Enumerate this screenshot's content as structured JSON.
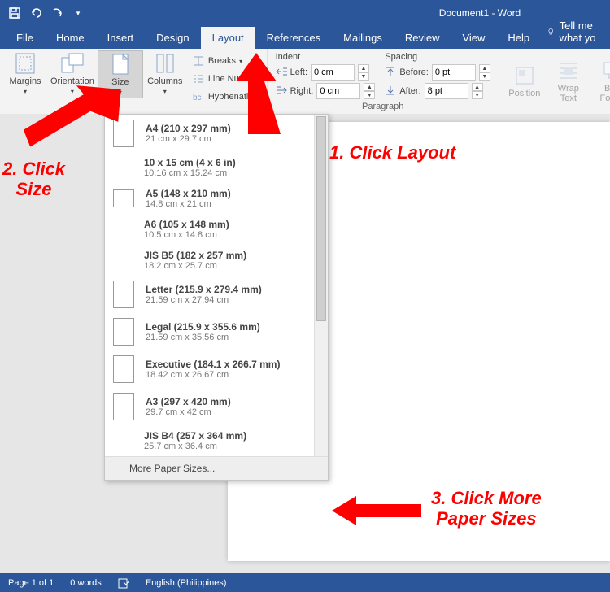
{
  "titlebar": {
    "document_title": "Document1 - Word"
  },
  "tabs": {
    "file": "File",
    "home": "Home",
    "insert": "Insert",
    "design": "Design",
    "layout": "Layout",
    "references": "References",
    "mailings": "Mailings",
    "review": "Review",
    "view": "View",
    "help": "Help",
    "tellme": "Tell me what yo"
  },
  "ribbon": {
    "page_setup": {
      "margins": "Margins",
      "orientation": "Orientation",
      "size": "Size",
      "columns": "Columns",
      "breaks": "Breaks",
      "line_numbers": "Line Nun",
      "hyphenation": "Hyphenation"
    },
    "indent": {
      "heading": "Indent",
      "left_label": "Left:",
      "left_value": "0 cm",
      "right_label": "Right:",
      "right_value": "0 cm"
    },
    "spacing": {
      "heading": "Spacing",
      "before_label": "Before:",
      "before_value": "0 pt",
      "after_label": "After:",
      "after_value": "8 pt"
    },
    "paragraph_label": "Paragraph",
    "arrange": {
      "position": "Position",
      "wrap_text": "Wrap\nText",
      "bring_forward": "Brin\nForwa"
    }
  },
  "size_menu": {
    "items": [
      {
        "title": "A4 (210 x 297 mm)",
        "sub": "21 cm x 29.7 cm",
        "thumb": "tall"
      },
      {
        "title": "10 x 15 cm (4 x 6 in)",
        "sub": "10.16 cm x 15.24 cm",
        "thumb": "none"
      },
      {
        "title": "A5 (148 x 210 mm)",
        "sub": "14.8 cm x 21 cm",
        "thumb": "small"
      },
      {
        "title": "A6 (105 x 148 mm)",
        "sub": "10.5 cm x 14.8 cm",
        "thumb": "none"
      },
      {
        "title": "JIS B5 (182 x 257 mm)",
        "sub": "18.2 cm x 25.7 cm",
        "thumb": "none"
      },
      {
        "title": "Letter (215.9 x 279.4 mm)",
        "sub": "21.59 cm x 27.94 cm",
        "thumb": "tall"
      },
      {
        "title": "Legal (215.9 x 355.6 mm)",
        "sub": "21.59 cm x 35.56 cm",
        "thumb": "tall"
      },
      {
        "title": "Executive (184.1 x 266.7 mm)",
        "sub": "18.42 cm x 26.67 cm",
        "thumb": "tall"
      },
      {
        "title": "A3 (297 x 420 mm)",
        "sub": "29.7 cm x 42 cm",
        "thumb": "tall"
      },
      {
        "title": "JIS B4 (257 x 364 mm)",
        "sub": "25.7 cm x 36.4 cm",
        "thumb": "none"
      }
    ],
    "more": "More Paper Sizes..."
  },
  "statusbar": {
    "page": "Page 1 of 1",
    "words": "0 words",
    "language": "English (Philippines)"
  },
  "annotations": {
    "a1": "1. Click Layout",
    "a2": "2. Click\nSize",
    "a3": "3. Click More\nPaper Sizes"
  }
}
